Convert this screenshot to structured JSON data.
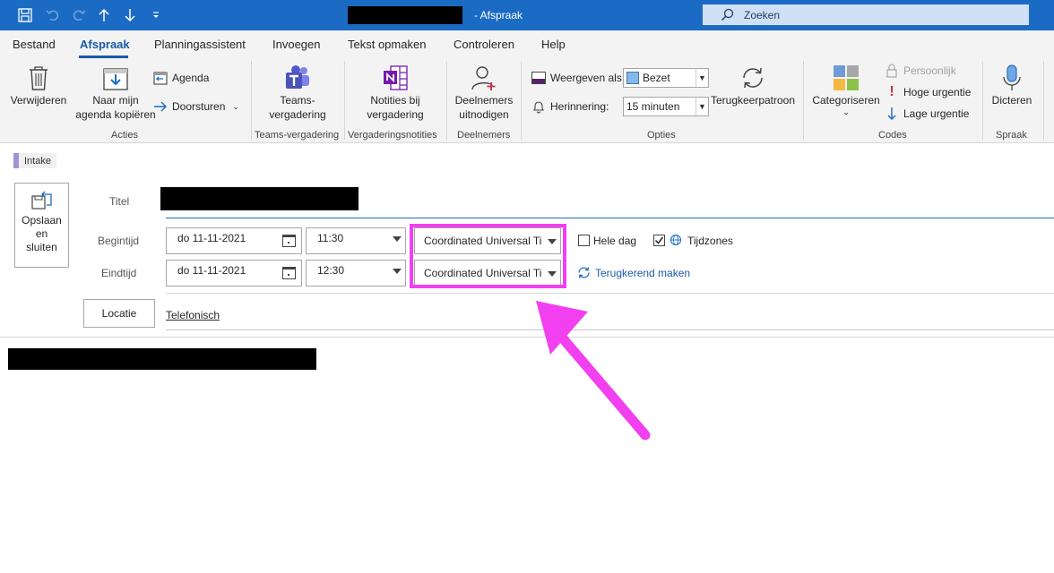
{
  "window": {
    "title_suffix": "- Afspraak",
    "search_label": "Zoeken"
  },
  "menu": {
    "tabs": [
      "Bestand",
      "Afspraak",
      "Planningassistent",
      "Invoegen",
      "Tekst opmaken",
      "Controleren",
      "Help"
    ],
    "active": "Afspraak"
  },
  "ribbon": {
    "acties": {
      "group_label": "Acties",
      "delete": "Verwijderen",
      "copy": "Naar mijn\nagenda kopiëren",
      "agenda": "Agenda",
      "forward": "Doorsturen"
    },
    "teams": {
      "group_label": "Teams-vergadering",
      "button": "Teams-\nvergadering"
    },
    "notes": {
      "group_label": "Vergaderingsnotities",
      "button": "Notities bij\nvergadering"
    },
    "attendees": {
      "group_label": "Deelnemers",
      "button": "Deelnemers\nuitnodigen"
    },
    "options": {
      "group_label": "Opties",
      "show_as_label": "Weergeven als:",
      "show_as_value": "Bezet",
      "reminder_label": "Herinnering:",
      "reminder_value": "15 minuten",
      "recurrence": "Terugkeerpatroon"
    },
    "codes": {
      "group_label": "Codes",
      "categorize": "Categoriseren",
      "private": "Persoonlijk",
      "high": "Hoge urgentie",
      "low": "Lage urgentie"
    },
    "speech": {
      "group_label": "Spraak",
      "dictate": "Dicteren"
    }
  },
  "category_tag": "Intake",
  "form": {
    "save_close": "Opslaan\nen\nsluiten",
    "title_label": "Titel",
    "start_label": "Begintijd",
    "end_label": "Eindtijd",
    "start_date": "do 11-11-2021",
    "start_time": "11:30",
    "start_tz": "Coordinated Universal Ti",
    "end_date": "do 11-11-2021",
    "end_time": "12:30",
    "end_tz": "Coordinated Universal Ti",
    "all_day": "Hele dag",
    "timezones": "Tijdzones",
    "make_recurring": "Terugkerend maken",
    "location_button": "Locatie",
    "location_value": "Telefonisch"
  },
  "colors": {
    "titlebar": "#1b6bc4",
    "accent": "#185aa8",
    "annotation": "#f23ff0"
  }
}
